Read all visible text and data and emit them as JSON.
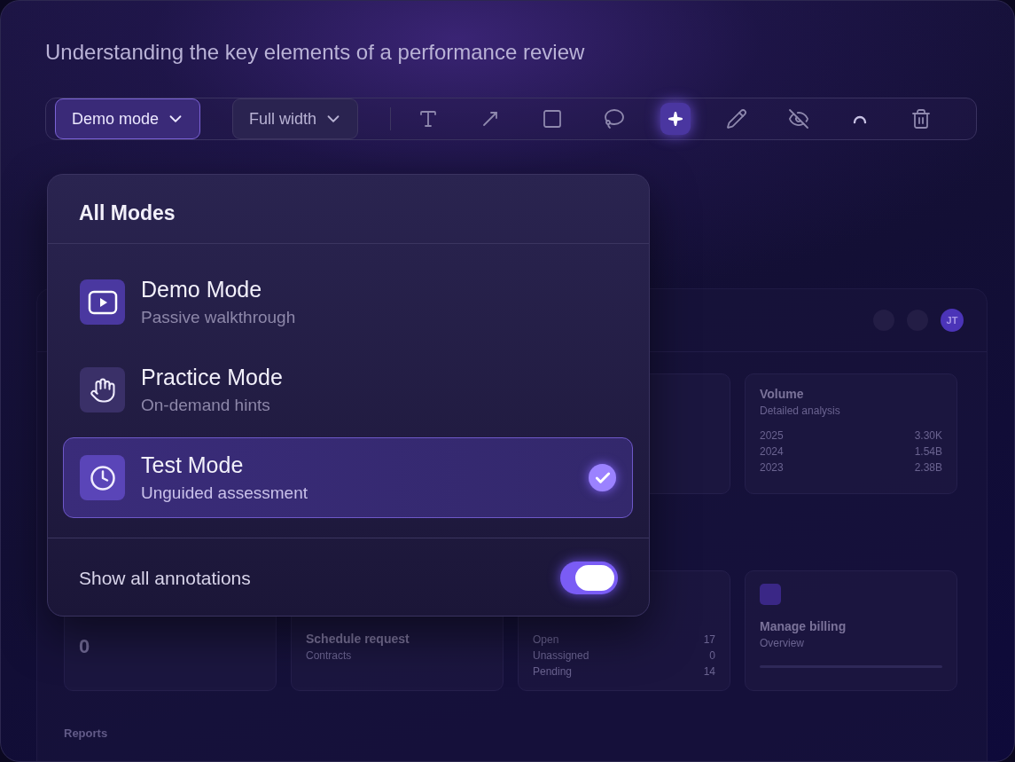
{
  "page_title": "Understanding the key elements of a performance review",
  "toolbar": {
    "mode_button": "Demo mode",
    "width_button": "Full width",
    "tools": [
      {
        "kind": "text",
        "selected": false
      },
      {
        "kind": "arrow",
        "selected": false
      },
      {
        "kind": "rectangle",
        "selected": false
      },
      {
        "kind": "lasso",
        "selected": false
      },
      {
        "kind": "sparkle",
        "selected": true
      },
      {
        "kind": "pencil",
        "selected": false
      },
      {
        "kind": "hide",
        "selected": false
      },
      {
        "kind": "arc",
        "selected": false
      },
      {
        "kind": "trash",
        "selected": false
      }
    ]
  },
  "mode_menu": {
    "title": "All Modes",
    "modes": [
      {
        "kind": "play",
        "title": "Demo Mode",
        "subtitle": "Passive walkthrough",
        "selected": false
      },
      {
        "kind": "hand",
        "title": "Practice Mode",
        "subtitle": "On-demand hints",
        "selected": false
      },
      {
        "kind": "clock",
        "title": "Test Mode",
        "subtitle": "Unguided assessment",
        "selected": true
      }
    ],
    "annotations_toggle": {
      "label": "Show all annotations",
      "on": true
    }
  },
  "dashboard": {
    "avatar": "JT",
    "volume_card": {
      "title": "Volume",
      "subtitle": "Detailed analysis",
      "rows": [
        [
          "2025",
          "3.30K"
        ],
        [
          "2024",
          "1.54B"
        ],
        [
          "2023",
          "2.38B"
        ]
      ]
    },
    "count_card": {
      "value": "0"
    },
    "request_card": {
      "title": "Schedule request",
      "subtitle": "Contracts"
    },
    "status_card": {
      "rows": [
        [
          "Open",
          "17"
        ],
        [
          "Unassigned",
          "0"
        ],
        [
          "Pending",
          "14"
        ]
      ]
    },
    "billing_card": {
      "title": "Manage billing",
      "subtitle": "Overview"
    },
    "section_label": "Reports"
  }
}
